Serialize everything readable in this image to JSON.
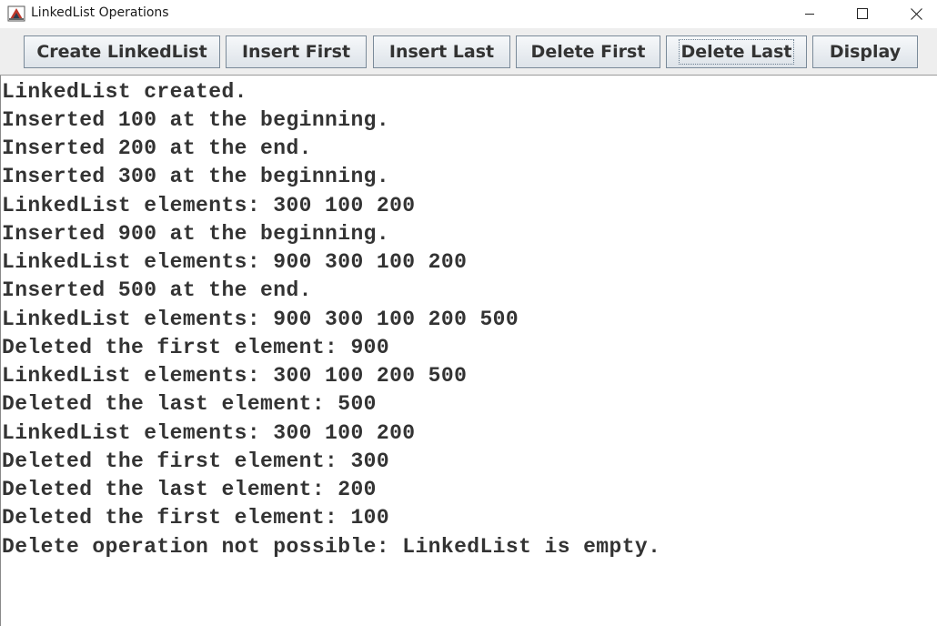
{
  "window": {
    "title": "LinkedList Operations",
    "icon": "java-app-icon",
    "controls": [
      "minimize-icon",
      "maximize-icon",
      "close-icon"
    ]
  },
  "toolbar": {
    "buttons": [
      {
        "label": "Create LinkedList"
      },
      {
        "label": "Insert First"
      },
      {
        "label": "Insert Last"
      },
      {
        "label": "Delete First"
      },
      {
        "label": "Delete Last",
        "focused": true
      },
      {
        "label": "Display"
      }
    ]
  },
  "output": {
    "lines": [
      "LinkedList created.",
      "Inserted 100 at the beginning.",
      "Inserted 200 at the end.",
      "Inserted 300 at the beginning.",
      "LinkedList elements: 300 100 200",
      "Inserted 900 at the beginning.",
      "LinkedList elements: 900 300 100 200",
      "Inserted 500 at the end.",
      "LinkedList elements: 900 300 100 200 500",
      "Deleted the first element: 900",
      "LinkedList elements: 300 100 200 500",
      "Deleted the last element: 500",
      "LinkedList elements: 300 100 200",
      "Deleted the first element: 300",
      "Deleted the last element: 200",
      "Deleted the first element: 100",
      "Delete operation not possible: LinkedList is empty."
    ]
  },
  "colors": {
    "toolbar_bg": "#eeeeee",
    "button_border": "#7a8a99",
    "text": "#333333"
  }
}
